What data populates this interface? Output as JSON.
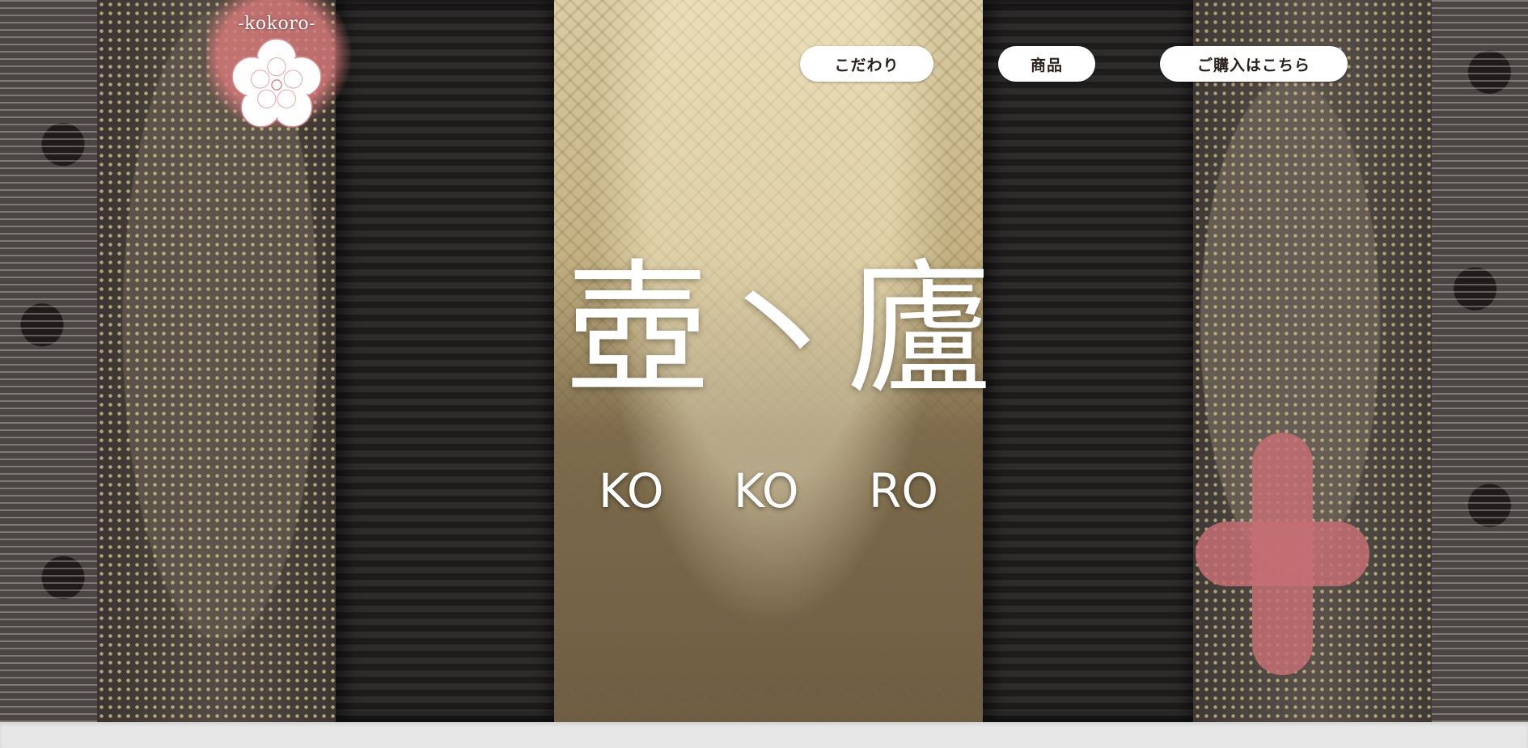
{
  "logo": {
    "text": "-kokoro-",
    "icon": "cherry-blossom-icon"
  },
  "nav": {
    "items": [
      {
        "label": "こだわり"
      },
      {
        "label": "商品"
      },
      {
        "label": "ご購入はこちら"
      }
    ]
  },
  "hero": {
    "title": "壺丶廬",
    "subtitle": [
      "KO",
      "KO",
      "RO"
    ]
  },
  "colors": {
    "button_bg": "#ffffff",
    "button_text": "#2a1f1a",
    "blossom_outline": "#d48a8f",
    "footer_strip": "#e6e6e6"
  }
}
